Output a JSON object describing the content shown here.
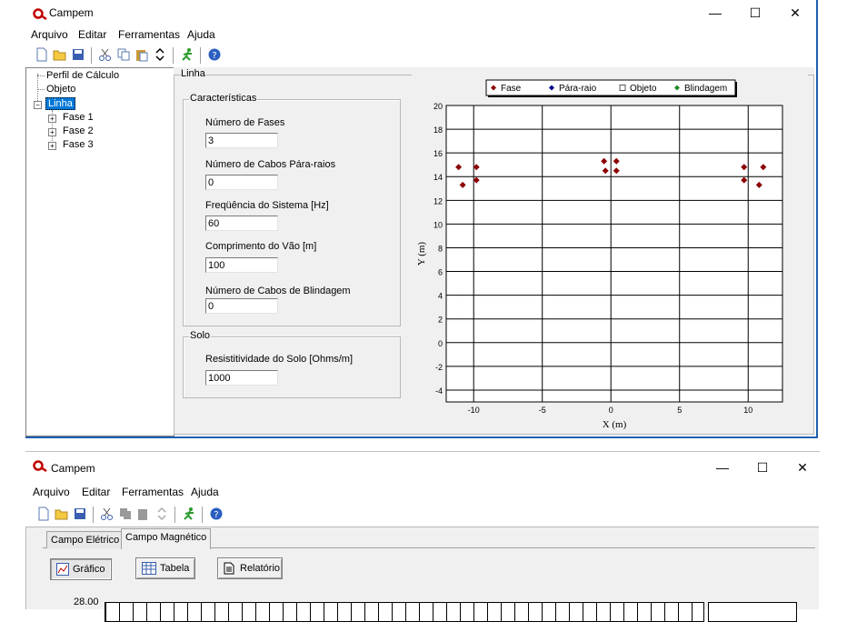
{
  "window1": {
    "title": "Campem",
    "menu": [
      "Arquivo",
      "Editar",
      "Ferramentas",
      "Ajuda"
    ],
    "controls": {
      "minimize": "—",
      "maximize": "☐",
      "close": "✕"
    },
    "tree": {
      "items": [
        "Perfil de Cálculo",
        "Objeto",
        "Linha"
      ],
      "children": [
        "Fase 1",
        "Fase 2",
        "Fase 3"
      ]
    },
    "panel_title": "Linha",
    "caracteristicas": {
      "title": "Características",
      "fields": [
        {
          "label": "Número de Fases",
          "value": "3"
        },
        {
          "label": "Número de Cabos Pára-raios",
          "value": "0"
        },
        {
          "label": "Freqüência do Sistema [Hz]",
          "value": "60"
        },
        {
          "label": "Comprimento do Vão [m]",
          "value": "100"
        },
        {
          "label": "Número de Cabos de Blindagem",
          "value": "0"
        }
      ]
    },
    "solo": {
      "title": "Solo",
      "field": {
        "label": "Resistitividade do Solo [Ohms/m]",
        "value": "1000"
      }
    }
  },
  "chart_data": {
    "type": "scatter",
    "legend": [
      "Fase",
      "Pára-raio",
      "Objeto",
      "Blindagem"
    ],
    "legend_colors": [
      "#8b0000",
      "#00008b",
      "#555555",
      "#228b22"
    ],
    "legend_position": "top",
    "xlabel": "X (m)",
    "ylabel": "Y (m)",
    "xlim": [
      -12,
      12.5
    ],
    "ylim": [
      -5,
      20
    ],
    "xticks": [
      "-10",
      "-5",
      "0",
      "5",
      "10"
    ],
    "xtick_values": [
      -10,
      -5,
      0,
      5,
      10
    ],
    "yticks": [
      "20",
      "18",
      "16",
      "14",
      "12",
      "10",
      "8",
      "6",
      "4",
      "2",
      "0",
      "-2",
      "-4"
    ],
    "ytick_values": [
      20,
      18,
      16,
      14,
      12,
      10,
      8,
      6,
      4,
      2,
      0,
      -2,
      -4
    ],
    "grid": true,
    "series": [
      {
        "name": "Fase",
        "points": [
          [
            -11.1,
            14.8
          ],
          [
            -9.8,
            14.8
          ],
          [
            -10.8,
            13.3
          ],
          [
            -9.8,
            13.7
          ],
          [
            -0.5,
            15.3
          ],
          [
            0.4,
            15.3
          ],
          [
            -0.4,
            14.5
          ],
          [
            0.4,
            14.5
          ],
          [
            9.7,
            14.8
          ],
          [
            11.1,
            14.8
          ],
          [
            9.7,
            13.7
          ],
          [
            10.8,
            13.3
          ]
        ]
      }
    ]
  },
  "window2": {
    "title": "Campem",
    "menu": [
      "Arquivo",
      "Editar",
      "Ferramentas",
      "Ajuda"
    ],
    "controls": {
      "minimize": "—",
      "maximize": "☐",
      "close": "✕"
    },
    "tabs": [
      "Campo Elétrico",
      "Campo Magnético"
    ],
    "buttons": [
      "Gráfico",
      "Tabela",
      "Relatório"
    ],
    "partial_tick": "28.00"
  }
}
